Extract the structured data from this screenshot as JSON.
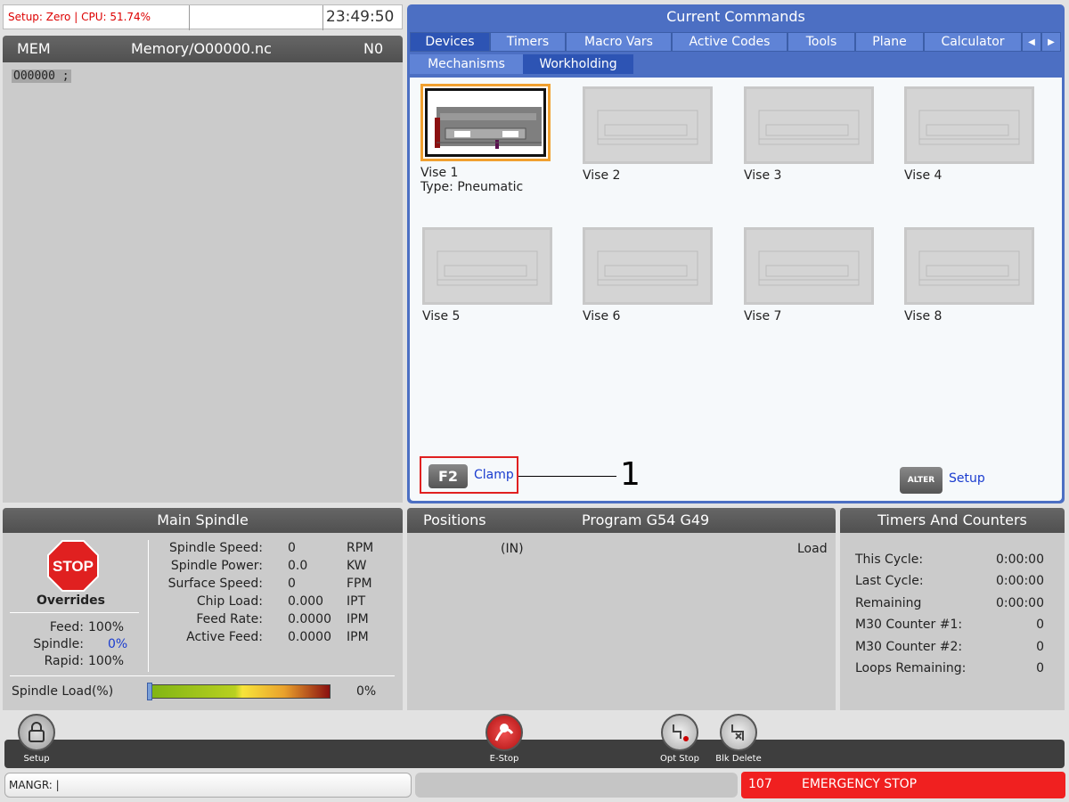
{
  "top_status": {
    "setup": "Setup: Zero | CPU: 51.74%",
    "clock": "23:49:50"
  },
  "memory": {
    "mode": "MEM",
    "file": "Memory/O00000.nc",
    "n": "N0",
    "program_line": "O00000 ;"
  },
  "commands": {
    "title": "Current Commands",
    "tabs": [
      "Devices",
      "Timers",
      "Macro Vars",
      "Active Codes",
      "Tools",
      "Plane",
      "Calculator"
    ],
    "active_tab": "Devices",
    "subtabs": [
      "Mechanisms",
      "Workholding"
    ],
    "active_subtab": "Workholding",
    "vises": [
      {
        "label": "Vise 1",
        "type": "Type: Pneumatic"
      },
      {
        "label": "Vise 2"
      },
      {
        "label": "Vise 3"
      },
      {
        "label": "Vise 4"
      },
      {
        "label": "Vise 5"
      },
      {
        "label": "Vise 6"
      },
      {
        "label": "Vise 7"
      },
      {
        "label": "Vise 8"
      }
    ],
    "f2_key": "F2",
    "f2_label": "Clamp",
    "callout": "1",
    "alter_key": "ALTER",
    "alter_label": "Setup"
  },
  "spindle": {
    "title": "Main Spindle",
    "stop_text": "STOP",
    "overrides_title": "Overrides",
    "overrides": [
      {
        "label": "Feed:",
        "value": "100%"
      },
      {
        "label": "Spindle:",
        "value": "0%"
      },
      {
        "label": "Rapid:",
        "value": "100%"
      }
    ],
    "rows": [
      {
        "label": "Spindle Speed:",
        "value": "0",
        "unit": "RPM"
      },
      {
        "label": "Spindle Power:",
        "value": "0.0",
        "unit": "KW"
      },
      {
        "label": "Surface Speed:",
        "value": "0",
        "unit": "FPM"
      },
      {
        "label": "Chip Load:",
        "value": "0.000",
        "unit": "IPT"
      },
      {
        "label": "Feed Rate:",
        "value": "0.0000",
        "unit": "IPM"
      },
      {
        "label": "Active Feed:",
        "value": "0.0000",
        "unit": "IPM"
      }
    ],
    "load_label": "Spindle Load(%)",
    "load_value": "0%",
    "load_fraction": 0.0
  },
  "positions": {
    "title": "Positions",
    "program": "Program G54 G49",
    "unit": "(IN)",
    "load": "Load"
  },
  "timers": {
    "title": "Timers And Counters",
    "rows": [
      {
        "label": "This Cycle:",
        "value": "0:00:00"
      },
      {
        "label": "Last Cycle:",
        "value": "0:00:00"
      },
      {
        "label": "Remaining",
        "value": "0:00:00"
      },
      {
        "label": "M30 Counter #1:",
        "value": "0"
      },
      {
        "label": "M30 Counter #2:",
        "value": "0"
      },
      {
        "label": "Loops Remaining:",
        "value": "0"
      }
    ]
  },
  "toolbar": {
    "setup": "Setup",
    "estop": "E-Stop",
    "opt_stop": "Opt Stop",
    "blk_delete": "Blk Delete"
  },
  "status": {
    "mangr": "MANGR: |",
    "alarm_code": "107",
    "alarm_text": "EMERGENCY STOP"
  },
  "colors": {
    "accent_blue": "#4c6fc3",
    "alarm_red": "#f02020",
    "highlight_orange": "#f0a030"
  }
}
